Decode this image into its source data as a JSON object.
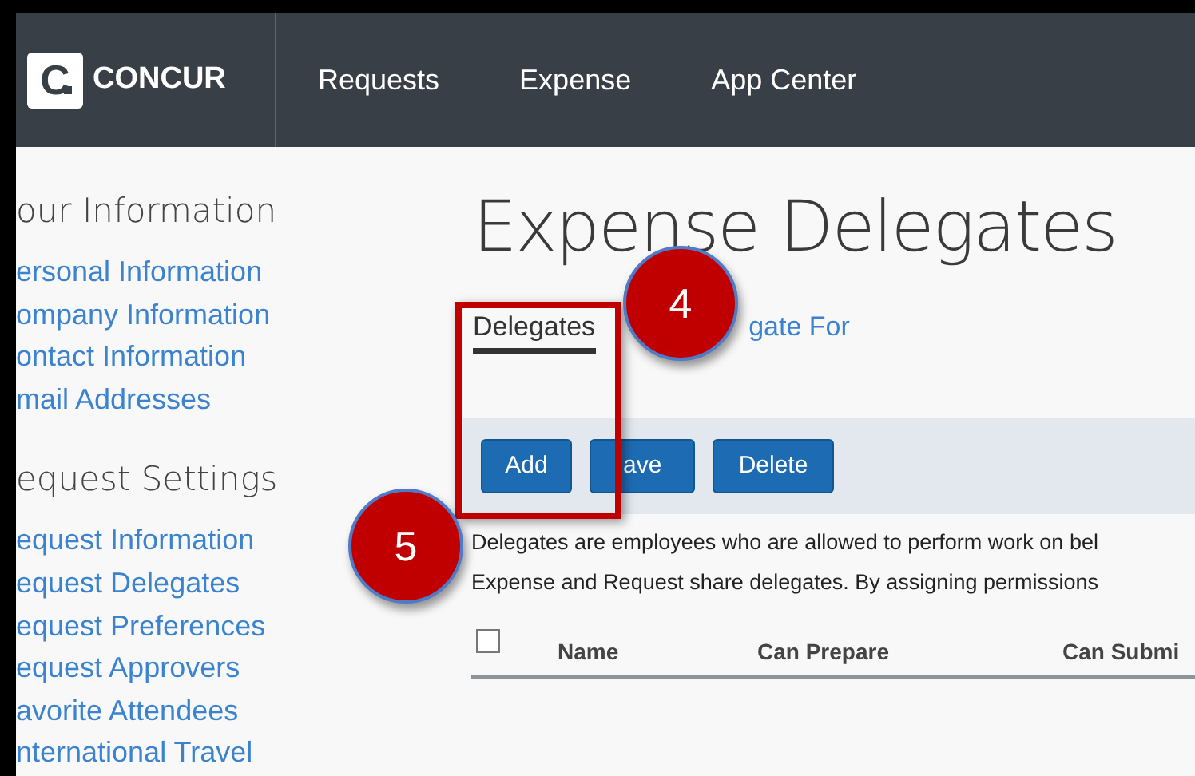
{
  "header": {
    "logo_mark": "C",
    "logo": "CONCUR",
    "nav": [
      {
        "label": "Requests"
      },
      {
        "label": "Expense"
      },
      {
        "label": "App Center"
      }
    ]
  },
  "sidebar": {
    "sections": [
      {
        "title": "our Information",
        "items": [
          "ersonal Information",
          "ompany Information",
          "ontact Information",
          "mail Addresses"
        ]
      },
      {
        "title": "equest Settings",
        "items": [
          "equest Information",
          "equest Delegates",
          "equest Preferences",
          "equest Approvers",
          "avorite Attendees",
          "nternational Travel"
        ]
      }
    ]
  },
  "page": {
    "title": "Expense Delegates",
    "tabs": [
      {
        "label": "Delegates",
        "selected": true
      },
      {
        "label": "gate For",
        "selected": false
      }
    ],
    "buttons": [
      "Add",
      "ave",
      "Delete"
    ],
    "description": [
      "Delegates are employees who are allowed to perform work on bel",
      "Expense and Request share delegates. By assigning permissions"
    ],
    "table": {
      "select_all": {
        "checked": false
      },
      "columns": [
        "Name",
        "Can Prepare",
        "Can Submi"
      ]
    }
  },
  "annotations": [
    {
      "kind": "box"
    },
    {
      "kind": "callout",
      "label": "4"
    },
    {
      "kind": "callout",
      "label": "5"
    }
  ]
}
